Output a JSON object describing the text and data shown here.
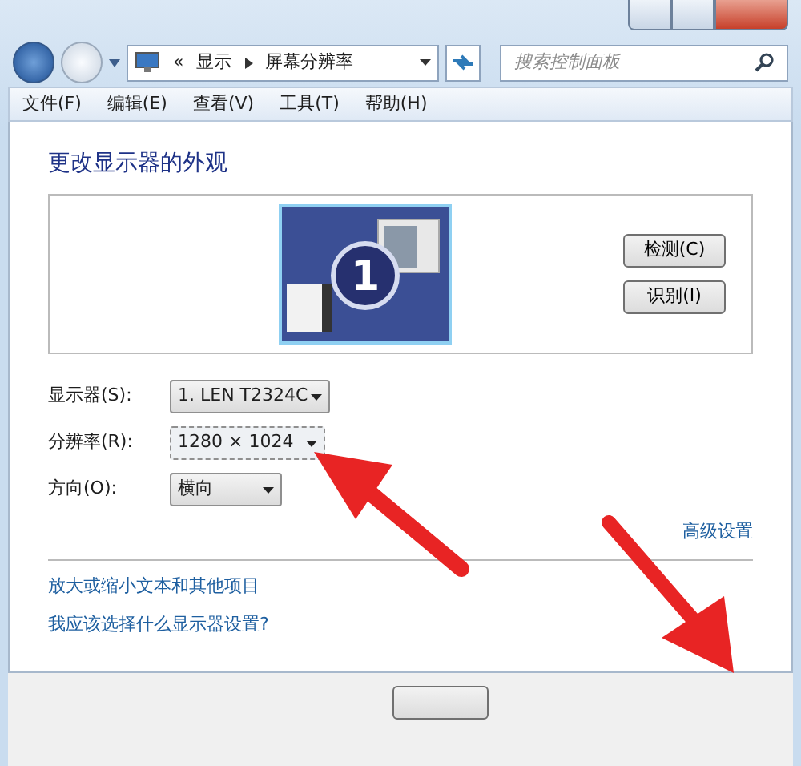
{
  "address_bar": {
    "overflow": "«",
    "crumbs": [
      "显示",
      "屏幕分辨率"
    ]
  },
  "search": {
    "placeholder": "搜索控制面板"
  },
  "menu": [
    "文件(F)",
    "编辑(E)",
    "查看(V)",
    "工具(T)",
    "帮助(H)"
  ],
  "heading": "更改显示器的外观",
  "preview": {
    "monitor_number": "1",
    "buttons": [
      "检测(C)",
      "识别(I)"
    ]
  },
  "settings": [
    {
      "label": "显示器(S):",
      "value": "1. LEN T2324C",
      "selected": false
    },
    {
      "label": "分辨率(R):",
      "value": "1280 × 1024",
      "selected": true
    },
    {
      "label": "方向(O):",
      "value": "横向",
      "selected": false
    }
  ],
  "advanced_link": "高级设置",
  "links": [
    "放大或缩小文本和其他项目",
    "我应该选择什么显示器设置?"
  ]
}
